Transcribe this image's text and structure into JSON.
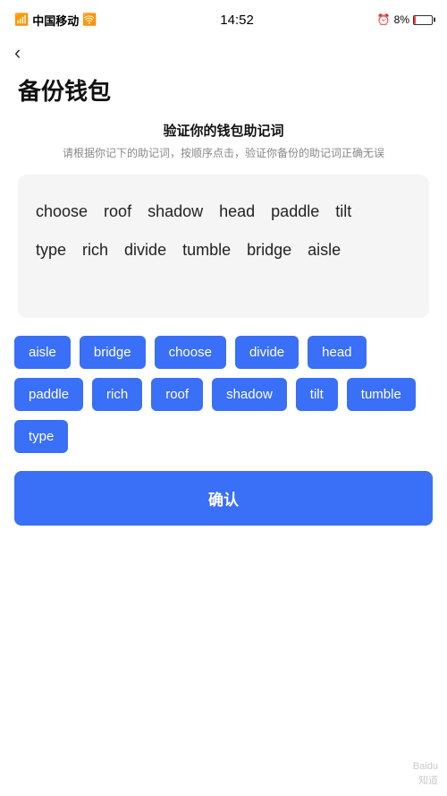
{
  "statusBar": {
    "carrier": "中国移动",
    "time": "14:52",
    "battery": "8%"
  },
  "backButton": {
    "label": "‹"
  },
  "pageTitle": "备份钱包",
  "section": {
    "heading": "验证你的钱包助记词",
    "desc": "请根据你记下的助记词，按顺序点击，验证你备份的助记词正确无误"
  },
  "displayWords": [
    "choose",
    "roof",
    "shadow",
    "head",
    "paddle",
    "tilt",
    "type",
    "rich",
    "divide",
    "tumble",
    "bridge",
    "aisle"
  ],
  "wordButtons": [
    "aisle",
    "bridge",
    "choose",
    "divide",
    "head",
    "paddle",
    "rich",
    "roof",
    "shadow",
    "tilt",
    "tumble",
    "type"
  ],
  "confirmButton": "确认",
  "watermark": {
    "line1": "Baidu",
    "line2": "知道"
  }
}
